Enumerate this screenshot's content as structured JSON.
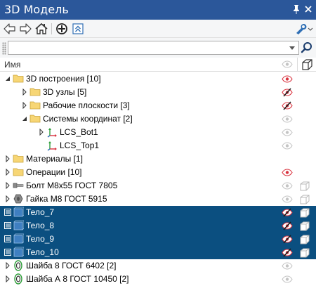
{
  "window": {
    "title": "3D Модель"
  },
  "search": {
    "value": "",
    "placeholder": ""
  },
  "columns": {
    "name": "Имя"
  },
  "tree": [
    {
      "label": "3D построения [10]",
      "level": 0,
      "expander": "expanded",
      "icon": "folder-icon",
      "visibility": "visible-red"
    },
    {
      "label": "3D узлы [5]",
      "level": 1,
      "expander": "collapsed",
      "icon": "folder-icon",
      "visibility": "hidden-red"
    },
    {
      "label": "Рабочие плоскости [3]",
      "level": 1,
      "expander": "collapsed",
      "icon": "folder-icon",
      "visibility": "hidden-red"
    },
    {
      "label": "Системы координат [2]",
      "level": 1,
      "expander": "expanded",
      "icon": "folder-icon",
      "visibility": "visible"
    },
    {
      "label": "LCS_Bot1",
      "level": 2,
      "expander": "collapsed",
      "icon": "axis-icon",
      "visibility": "visible"
    },
    {
      "label": "LCS_Top1",
      "level": 2,
      "expander": "none",
      "icon": "axis-icon",
      "visibility": "visible"
    },
    {
      "label": "Материалы [1]",
      "level": 0,
      "expander": "collapsed",
      "icon": "folder-icon",
      "visibility": "none"
    },
    {
      "label": "Операции [10]",
      "level": 0,
      "expander": "collapsed",
      "icon": "folder-icon",
      "visibility": "visible-red"
    },
    {
      "label": "Болт М8х55 ГОСТ 7805",
      "level": 0,
      "expander": "collapsed",
      "icon": "bolt-icon",
      "visibility": "visible",
      "cube": true
    },
    {
      "label": "Гайка М8 ГОСТ 5915",
      "level": 0,
      "expander": "collapsed",
      "icon": "nut-icon",
      "visibility": "visible",
      "cube": true
    },
    {
      "label": "Тело_7",
      "level": 0,
      "expander": "list",
      "icon": "body-icon",
      "visibility": "hidden-red",
      "cube": true,
      "selected": true
    },
    {
      "label": "Тело_8",
      "level": 0,
      "expander": "list",
      "icon": "body-icon",
      "visibility": "hidden-red",
      "cube": true,
      "selected": true
    },
    {
      "label": "Тело_9",
      "level": 0,
      "expander": "list",
      "icon": "body-icon",
      "visibility": "hidden-red",
      "cube": true,
      "selected": true
    },
    {
      "label": "Тело_10",
      "level": 0,
      "expander": "list",
      "icon": "body-icon",
      "visibility": "hidden-red",
      "cube": true,
      "selected": true
    },
    {
      "label": "Шайба 8 ГОСТ 6402 [2]",
      "level": 0,
      "expander": "collapsed",
      "icon": "washer-icon",
      "visibility": "visible"
    },
    {
      "label": "Шайба А 8 ГОСТ 10450 [2]",
      "level": 0,
      "expander": "collapsed",
      "icon": "washer-icon",
      "visibility": "visible"
    }
  ],
  "colors": {
    "titlebar": "#2b579a",
    "selection": "#0b4f80",
    "folder": "#f7d675",
    "hidden_red": "#d9333f"
  }
}
